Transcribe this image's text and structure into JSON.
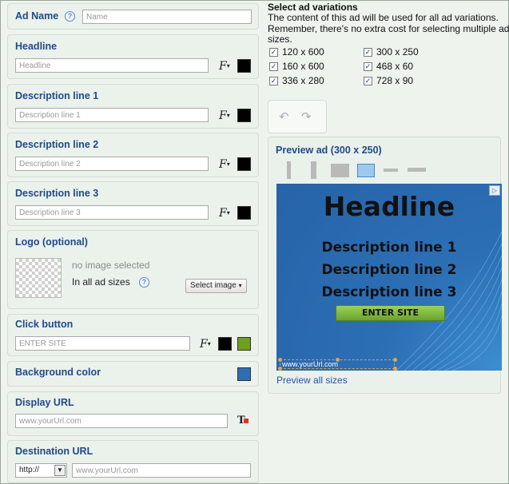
{
  "form": {
    "ad_name": {
      "label": "Ad Name",
      "placeholder": "Name"
    },
    "headline": {
      "label": "Headline",
      "placeholder": "Headline"
    },
    "desc1": {
      "label": "Description line 1",
      "placeholder": "Description line 1"
    },
    "desc2": {
      "label": "Description line 2",
      "placeholder": "Description line 2"
    },
    "desc3": {
      "label": "Description line 3",
      "placeholder": "Description line 3"
    },
    "logo": {
      "label": "Logo (optional)",
      "status": "no image selected",
      "scope": "In all ad sizes",
      "select_label": "Select image"
    },
    "click_button": {
      "label": "Click button",
      "placeholder": "ENTER SITE"
    },
    "background": {
      "label": "Background color"
    },
    "display_url": {
      "label": "Display URL",
      "placeholder": "www.yourUrl.com"
    },
    "destination_url": {
      "label": "Destination URL",
      "protocol": "http://",
      "placeholder": "www.yourUrl.com"
    }
  },
  "variations": {
    "title": "Select ad variations",
    "desc_line1": "The content of this ad will be used for all ad variations.",
    "desc_line2": "Remember, there's no extra cost for selecting multiple ad",
    "desc_line3": "sizes.",
    "sizes": [
      "120 x 600",
      "300 x 250",
      "160 x 600",
      "468 x 60",
      "336 x 280",
      "728 x 90"
    ]
  },
  "preview": {
    "title": "Preview ad (300 x 250)",
    "headline": "Headline",
    "line1": "Description line 1",
    "line2": "Description line 2",
    "line3": "Description line 3",
    "button": "ENTER SITE",
    "url": "www.yourUrl.com",
    "all_sizes_link": "Preview all sizes"
  },
  "colors": {
    "font_swatch": "#000000",
    "button_color": "#6e9f1e",
    "background_color": "#2f6db1",
    "label_blue": "#1f4a8c"
  }
}
